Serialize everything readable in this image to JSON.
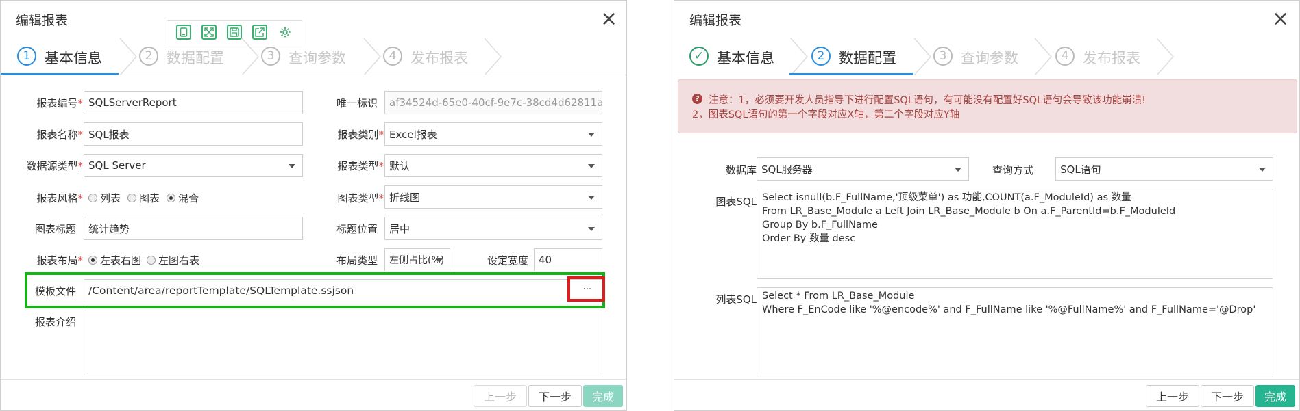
{
  "left": {
    "title": "编辑报表",
    "close": "×",
    "toolbar": [
      "mobile-icon",
      "fullscreen-icon",
      "save-icon",
      "export-icon",
      "settings-icon"
    ],
    "steps": [
      {
        "num": "1",
        "label": "基本信息"
      },
      {
        "num": "2",
        "label": "数据配置"
      },
      {
        "num": "3",
        "label": "查询参数"
      },
      {
        "num": "4",
        "label": "发布报表"
      }
    ],
    "labels": {
      "report_no": "报表编号",
      "report_name": "报表名称",
      "ds_type": "数据源类型",
      "style": "报表风格",
      "chart_title": "图表标题",
      "layout": "报表布局",
      "template": "模板文件",
      "intro": "报表介绍",
      "uid": "唯一标识",
      "report_kind": "报表类别",
      "report_type": "报表类型",
      "chart_type": "图表类型",
      "title_pos": "标题位置",
      "layout_type": "布局类型",
      "width": "设定宽度"
    },
    "req": "*",
    "values": {
      "report_no": "SQLServerReport",
      "report_name": "SQL报表",
      "ds_type": "SQL Server",
      "chart_title": "统计趋势",
      "template": "/Content/area/reportTemplate/SQLTemplate.ssjson",
      "intro": "",
      "uid": "af34524d-65e0-40cf-9e7c-38cd4d62811a",
      "report_kind": "Excel报表",
      "report_type": "默认",
      "chart_type": "折线图",
      "title_pos": "居中",
      "layout_type": "左侧占比(%)",
      "width": "40"
    },
    "style_options": [
      {
        "label": "列表",
        "on": false
      },
      {
        "label": "图表",
        "on": false
      },
      {
        "label": "混合",
        "on": true
      }
    ],
    "layout_options": [
      {
        "label": "左表右图",
        "on": true
      },
      {
        "label": "左图右表",
        "on": false
      }
    ],
    "ellipsis": "···",
    "buttons": {
      "prev": "上一步",
      "next": "下一步",
      "finish": "完成"
    }
  },
  "right": {
    "title": "编辑报表",
    "close": "×",
    "steps": [
      {
        "num": "✓",
        "label": "基本信息"
      },
      {
        "num": "2",
        "label": "数据配置"
      },
      {
        "num": "3",
        "label": "查询参数"
      },
      {
        "num": "4",
        "label": "发布报表"
      }
    ],
    "alert": {
      "icon": "?",
      "line1": "注意：1，必须要开发人员指导下进行配置SQL语句，有可能没有配置好SQL语句会导致该功能崩溃!",
      "line2": "2，图表SQL语句的第一个字段对应X轴，第二个字段对应Y轴"
    },
    "labels": {
      "db": "数据库",
      "query_mode": "查询方式",
      "chart_sql": "图表SQL",
      "list_sql": "列表SQL"
    },
    "values": {
      "db": "SQL服务器",
      "query_mode": "SQL语句",
      "chart_sql": "Select isnull(b.F_FullName,'顶级菜单') as 功能,COUNT(a.F_ModuleId) as 数量\nFrom LR_Base_Module a Left Join LR_Base_Module b On a.F_ParentId=b.F_ModuleId\nGroup By b.F_FullName\nOrder By 数量 desc",
      "list_sql": "Select * From LR_Base_Module\nWhere F_EnCode like '%@encode%' and F_FullName like '%@FullName%' and F_FullName='@Drop'"
    },
    "buttons": {
      "prev": "上一步",
      "next": "下一步",
      "finish": "完成"
    }
  }
}
